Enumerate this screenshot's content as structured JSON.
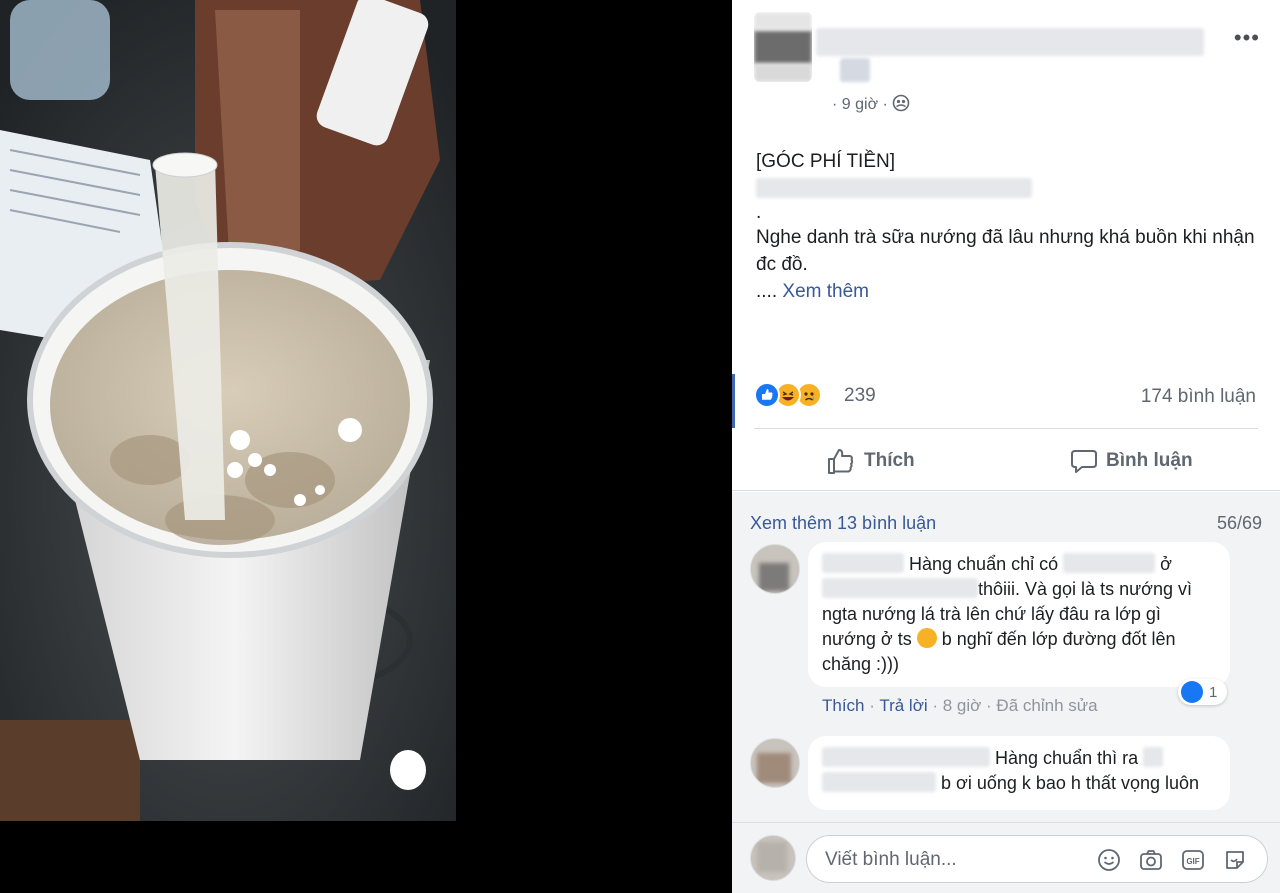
{
  "post": {
    "time_meta": "· 9 giờ ·",
    "text_line1": "[GÓC PHÍ TIỀN]",
    "text_dot": ".",
    "text_body": "Nghe danh trà sữa nướng đã lâu nhưng khá buồn khi nhận đc đồ.",
    "text_ellipsis": "....",
    "see_more": "Xem thêm",
    "reaction_count": "239",
    "comment_count": "174 bình luận",
    "more_icon": "more-horizontal-icon",
    "privacy_icon": "friends-privacy-icon"
  },
  "actions": {
    "like_label": "Thích",
    "comment_label": "Bình luận"
  },
  "comments_header": {
    "view_more": "Xem thêm 13 bình luận",
    "counter": "56/69"
  },
  "comments": [
    {
      "part1": "Hàng chuẩn chỉ có",
      "part2": "ở",
      "part3": "thôiii. Và gọi là ts nướng vì ngta nướng lá trà lên chứ lấy đâu ra lớp gì nướng ở ts",
      "part4": "b nghĩ đến lớp đường đốt lên chăng :)))",
      "like_action": "Thích",
      "reply_action": "Trả lời",
      "time": "8 giờ",
      "edited": "Đã chỉnh sửa",
      "like_count": "1"
    },
    {
      "part1": "Hàng chuẩn thì ra",
      "part2": "b ơi uống k bao h thất vọng luôn"
    }
  ],
  "composer": {
    "placeholder": "Viết bình luận..."
  },
  "colors": {
    "link": "#385898",
    "like_blue": "#1877f2",
    "haha_yellow": "#f7b125",
    "muted": "#606770",
    "comment_bg": "#f2f3f5"
  }
}
